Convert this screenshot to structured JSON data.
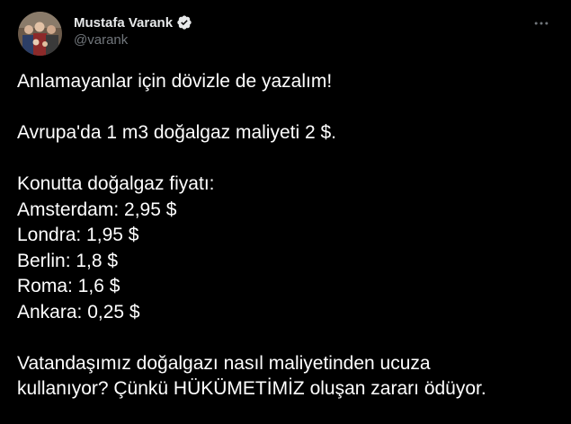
{
  "author": {
    "display_name": "Mustafa Varank",
    "handle": "@varank",
    "verified": true,
    "verified_color": "#e7e9ea"
  },
  "icons": {
    "verified": "verified-badge-icon",
    "more": "more-options-icon"
  },
  "tweet": {
    "intro": "Anlamayanlar için dövizle de yazalım!",
    "europe_cost": "Avrupa'da 1 m3 doğalgaz maliyeti 2 $.",
    "price_heading": "Konutta doğalgaz fiyatı:",
    "prices": [
      "Amsterdam: 2,95 $",
      "Londra: 1,95 $",
      "Berlin: 1,8 $",
      "Roma: 1,6 $",
      "Ankara: 0,25 $"
    ],
    "closing_line1": "Vatandaşımız doğalgazı nasıl maliyetinden ucuza",
    "closing_line2": "kullanıyor? Çünkü HÜKÜMETİMİZ oluşan zararı ödüyor."
  }
}
